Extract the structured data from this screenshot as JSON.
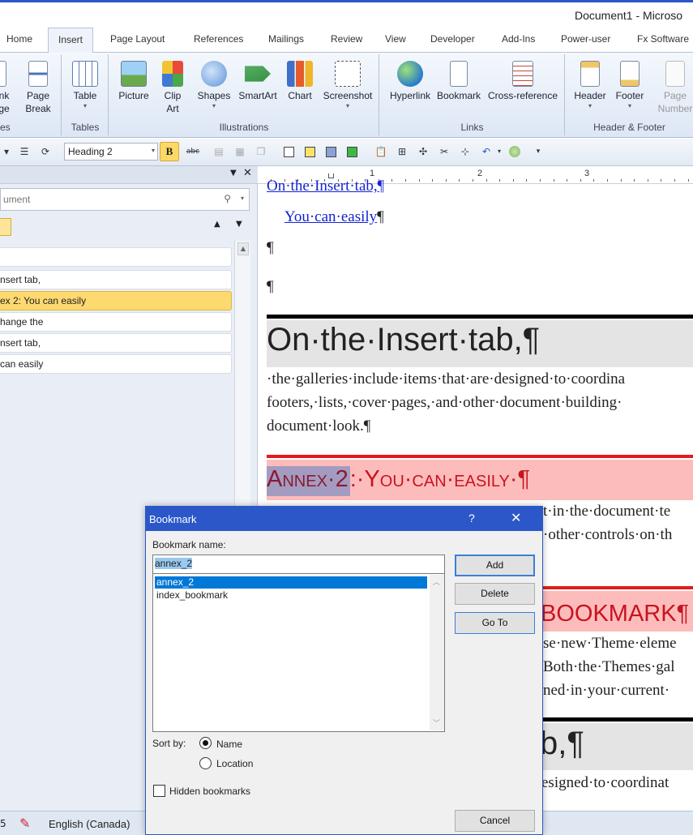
{
  "window": {
    "title": "Document1 - Microso"
  },
  "ribbon_tabs": [
    "Home",
    "Insert",
    "Page Layout",
    "References",
    "Mailings",
    "Review",
    "View",
    "Developer",
    "Add-Ins",
    "Power-user",
    "Fx Software"
  ],
  "ribbon": {
    "pages_group": {
      "btn1_l1": "nk",
      "btn1_l2": "ge",
      "label": "es",
      "page_break_l1": "Page",
      "page_break_l2": "Break"
    },
    "tables_group": {
      "table": "Table",
      "label": "Tables"
    },
    "illustrations_group": {
      "picture": "Picture",
      "clip_art_l1": "Clip",
      "clip_art_l2": "Art",
      "shapes": "Shapes",
      "smartart": "SmartArt",
      "chart": "Chart",
      "screenshot": "Screenshot",
      "label": "Illustrations"
    },
    "links_group": {
      "hyperlink": "Hyperlink",
      "bookmark": "Bookmark",
      "cross_reference": "Cross-reference",
      "label": "Links"
    },
    "header_footer_group": {
      "header": "Header",
      "footer": "Footer",
      "page_number_l1": "Page",
      "page_number_l2": "Number",
      "label": "Header & Footer"
    }
  },
  "qat": {
    "style_value": "Heading 2",
    "bold": "B",
    "strike": "abc"
  },
  "nav_pane": {
    "search_placeholder": "ument",
    "items": [
      "",
      "nsert tab,",
      "ex 2: You can easily",
      "hange the",
      "nsert tab,",
      "can easily"
    ]
  },
  "ruler": {
    "marks": [
      "1",
      "2",
      "3"
    ]
  },
  "document": {
    "line_top": "On·the·Insert·tab,¶",
    "link2": "You·can·easily",
    "pilcrow": "¶",
    "heading1": "On·the·Insert·tab,¶",
    "body1": [
      "·the·galleries·include·items·that·are·designed·to·coordina",
      "footers,·lists,·cover·pages,·and·other·document·building·",
      "document·look.¶"
    ],
    "annex_prefix": "Annex·2",
    "annex_rest": ":·You·can·easily·¶",
    "body2": [
      "t·in·the·document·te",
      "·other·controls·on·th"
    ],
    "bookmark_heading": "BOOKMARK¶",
    "body3": [
      "se·new·Theme·eleme",
      "Both·the·Themes·gal",
      "ned·in·your·current·"
    ],
    "heading_bottom": "b,¶",
    "body4": "esigned·to·coordinat"
  },
  "dialog": {
    "title": "Bookmark",
    "help": "?",
    "name_label": "Bookmark name:",
    "name_value": "annex_2",
    "list": [
      "annex_2",
      "index_bookmark"
    ],
    "add": "Add",
    "delete": "Delete",
    "goto": "Go To",
    "cancel": "Cancel",
    "sort_by": "Sort by:",
    "sort_name": "Name",
    "sort_location": "Location",
    "hidden": "Hidden bookmarks"
  },
  "status": {
    "left": "5",
    "language": "English (Canada)"
  }
}
